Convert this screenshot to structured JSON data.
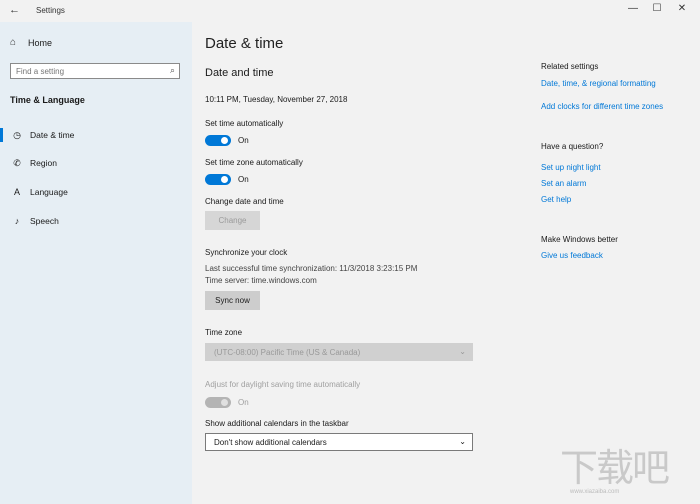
{
  "window": {
    "title": "Settings",
    "back_icon": "←",
    "minimize": "—",
    "maximize": "☐",
    "close": "✕"
  },
  "sidebar": {
    "home_icon": "⌂",
    "home_label": "Home",
    "search_placeholder": "Find a setting",
    "search_icon": "⌕",
    "section_title": "Time & Language",
    "items": [
      {
        "icon": "◷",
        "label": "Date & time",
        "active": true
      },
      {
        "icon": "✆",
        "label": "Region"
      },
      {
        "icon": "A",
        "label": "Language"
      },
      {
        "icon": "♪",
        "label": "Speech"
      }
    ]
  },
  "main": {
    "page_title": "Date & time",
    "section_title": "Date and time",
    "current_time": "10:11 PM, Tuesday, November 27, 2018",
    "set_time_auto": {
      "label": "Set time automatically",
      "state": "On"
    },
    "set_tz_auto": {
      "label": "Set time zone automatically",
      "state": "On"
    },
    "change_dt": {
      "label": "Change date and time",
      "button": "Change"
    },
    "sync": {
      "title": "Synchronize your clock",
      "last_sync": "Last successful time synchronization: 11/3/2018 3:23:15 PM",
      "server": "Time server: time.windows.com",
      "button": "Sync now"
    },
    "timezone": {
      "label": "Time zone",
      "value": "(UTC-08:00) Pacific Time (US & Canada)"
    },
    "dst": {
      "label": "Adjust for daylight saving time automatically",
      "state": "On"
    },
    "calendars": {
      "label": "Show additional calendars in the taskbar",
      "value": "Don't show additional calendars"
    }
  },
  "related": {
    "title": "Related settings",
    "link1": "Date, time, & regional formatting",
    "link2": "Add clocks for different time zones",
    "question_title": "Have a question?",
    "q_link1": "Set up night light",
    "q_link2": "Set an alarm",
    "q_link3": "Get help",
    "better_title": "Make Windows better",
    "feedback": "Give us feedback"
  },
  "watermark": {
    "text": "下载吧",
    "url": "www.xiazaiba.com"
  },
  "colors": {
    "accent": "#0078d7",
    "sidebar_bg": "#e6eef4",
    "main_bg": "#f2f2f2"
  }
}
